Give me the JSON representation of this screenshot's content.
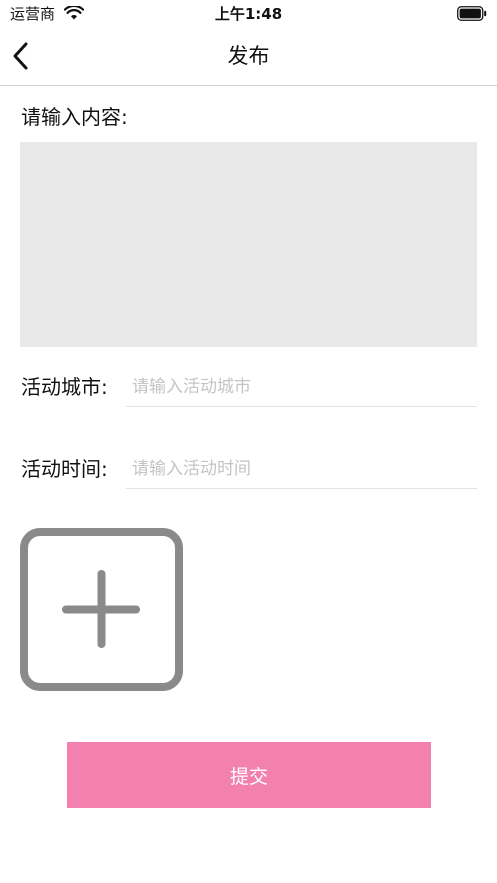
{
  "status_bar": {
    "carrier": "运营商",
    "time": "上午1:48"
  },
  "nav": {
    "title": "发布",
    "back_icon": "chevron-left-icon"
  },
  "content": {
    "label": "请输入内容:",
    "value": ""
  },
  "city": {
    "label": "活动城市:",
    "placeholder": "请输入活动城市",
    "value": ""
  },
  "time_field": {
    "label": "活动时间:",
    "placeholder": "请输入活动时间",
    "value": ""
  },
  "photo": {
    "icon": "add-photo-icon"
  },
  "submit": {
    "label": "提交",
    "color": "#f381b0"
  }
}
